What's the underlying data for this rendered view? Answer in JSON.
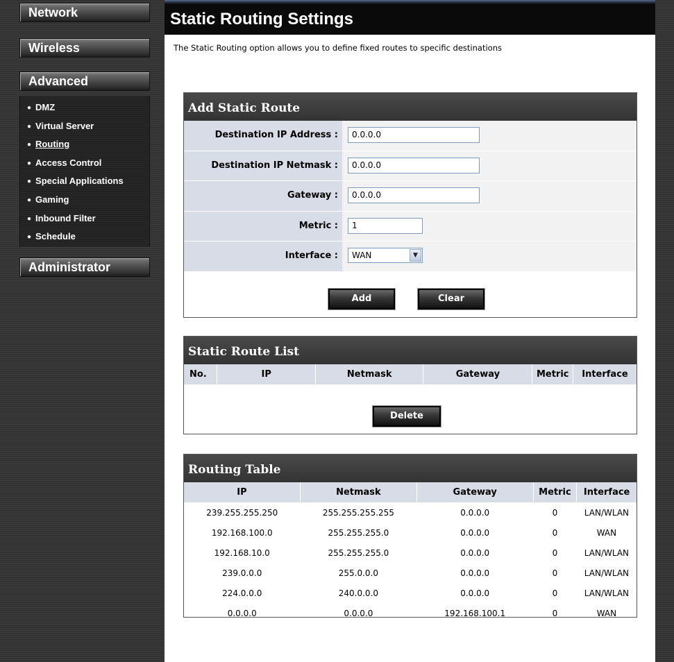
{
  "sidebar": {
    "network": "Network",
    "wireless": "Wireless",
    "advanced": "Advanced",
    "advanced_items": [
      {
        "label": "DMZ"
      },
      {
        "label": "Virtual Server"
      },
      {
        "label": "Routing"
      },
      {
        "label": "Access Control"
      },
      {
        "label": "Special Applications"
      },
      {
        "label": "Gaming"
      },
      {
        "label": "Inbound Filter"
      },
      {
        "label": "Schedule"
      }
    ],
    "active_item": "Routing",
    "administrator": "Administrator"
  },
  "page": {
    "title": "Static Routing Settings",
    "description": "The Static Routing option allows you to define fixed routes to specific destinations"
  },
  "add_route": {
    "heading": "Add Static Route",
    "dest_ip_label": "Destination IP Address :",
    "dest_ip_value": "0.0.0.0",
    "netmask_label": "Destination IP Netmask :",
    "netmask_value": "0.0.0.0",
    "gateway_label": "Gateway :",
    "gateway_value": "0.0.0.0",
    "metric_label": "Metric :",
    "metric_value": "1",
    "interface_label": "Interface :",
    "interface_value": "WAN",
    "add_button": "Add",
    "clear_button": "Clear"
  },
  "route_list": {
    "heading": "Static Route List",
    "columns": [
      "No.",
      "IP",
      "Netmask",
      "Gateway",
      "Metric",
      "Interface"
    ],
    "delete_button": "Delete"
  },
  "routing_table": {
    "heading": "Routing Table",
    "columns": [
      "IP",
      "Netmask",
      "Gateway",
      "Metric",
      "Interface"
    ],
    "rows": [
      [
        "239.255.255.250",
        "255.255.255.255",
        "0.0.0.0",
        "0",
        "LAN/WLAN"
      ],
      [
        "192.168.100.0",
        "255.255.255.0",
        "0.0.0.0",
        "0",
        "WAN"
      ],
      [
        "192.168.10.0",
        "255.255.255.0",
        "0.0.0.0",
        "0",
        "LAN/WLAN"
      ],
      [
        "239.0.0.0",
        "255.0.0.0",
        "0.0.0.0",
        "0",
        "LAN/WLAN"
      ],
      [
        "224.0.0.0",
        "240.0.0.0",
        "0.0.0.0",
        "0",
        "LAN/WLAN"
      ],
      [
        "0.0.0.0",
        "0.0.0.0",
        "192.168.100.1",
        "0",
        "WAN"
      ]
    ]
  },
  "colors": {
    "label_bg": "#d8dce6",
    "panel_header": "#333333",
    "sidebar_bg": "#333333"
  }
}
